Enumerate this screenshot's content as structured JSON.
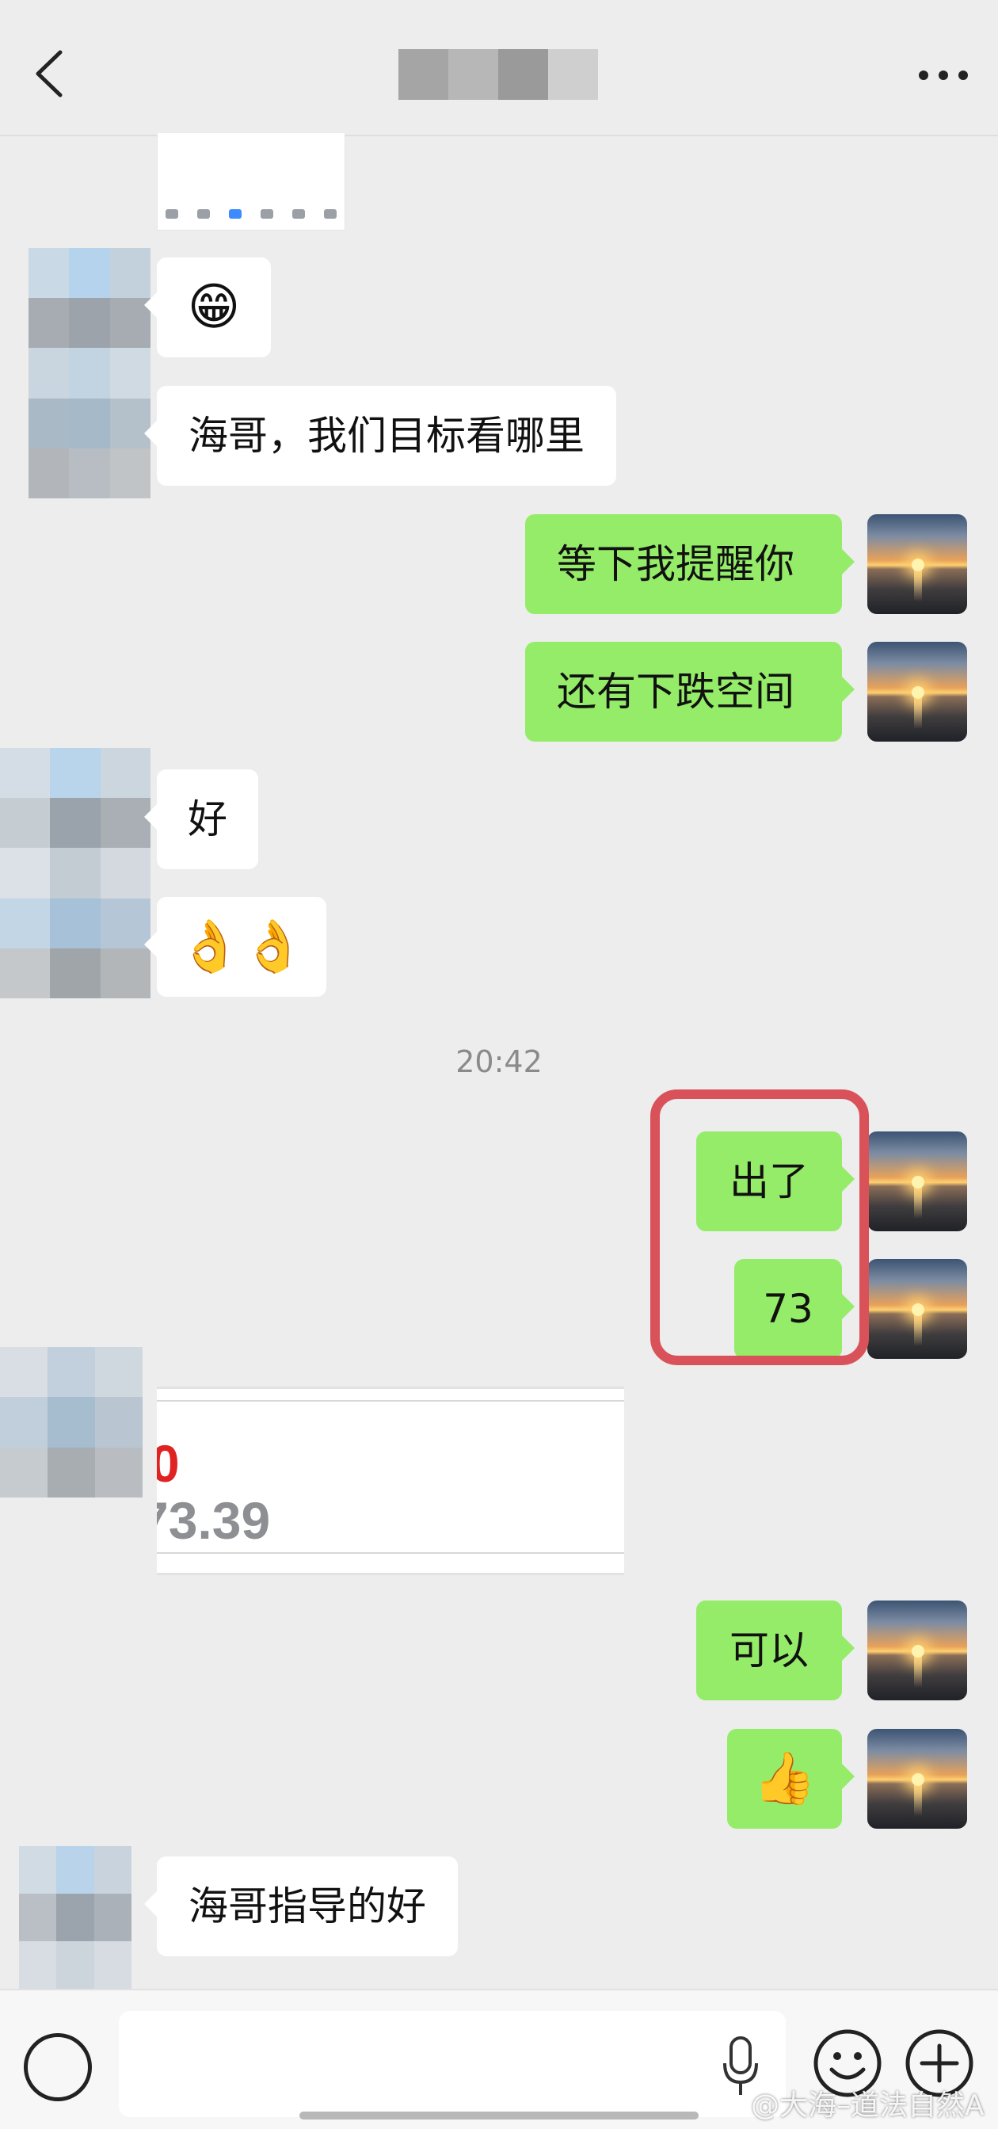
{
  "chat": {
    "messages": [
      {
        "side": "left",
        "text": "😁"
      },
      {
        "side": "left",
        "text": "海哥，我们目标看哪里"
      },
      {
        "side": "right",
        "text": "等下我提醒你"
      },
      {
        "side": "right",
        "text": "还有下跌空间"
      },
      {
        "side": "left",
        "text": "好"
      },
      {
        "side": "left",
        "text": "👌👌"
      },
      {
        "side": "right",
        "text": "出了"
      },
      {
        "side": "right",
        "text": "73"
      },
      {
        "side": "right",
        "text": "可以"
      },
      {
        "side": "right",
        "text": "👍"
      },
      {
        "side": "left",
        "text": "海哥指导的好"
      }
    ],
    "time_separator": "20:42",
    "image_card": {
      "line1": "0",
      "line2": "73.39"
    }
  },
  "watermark": "@大海–道法自然A",
  "colors": {
    "bubble_self": "#95ec69",
    "bubble_other": "#ffffff",
    "highlight": "#d9525a",
    "background": "#ededed"
  }
}
